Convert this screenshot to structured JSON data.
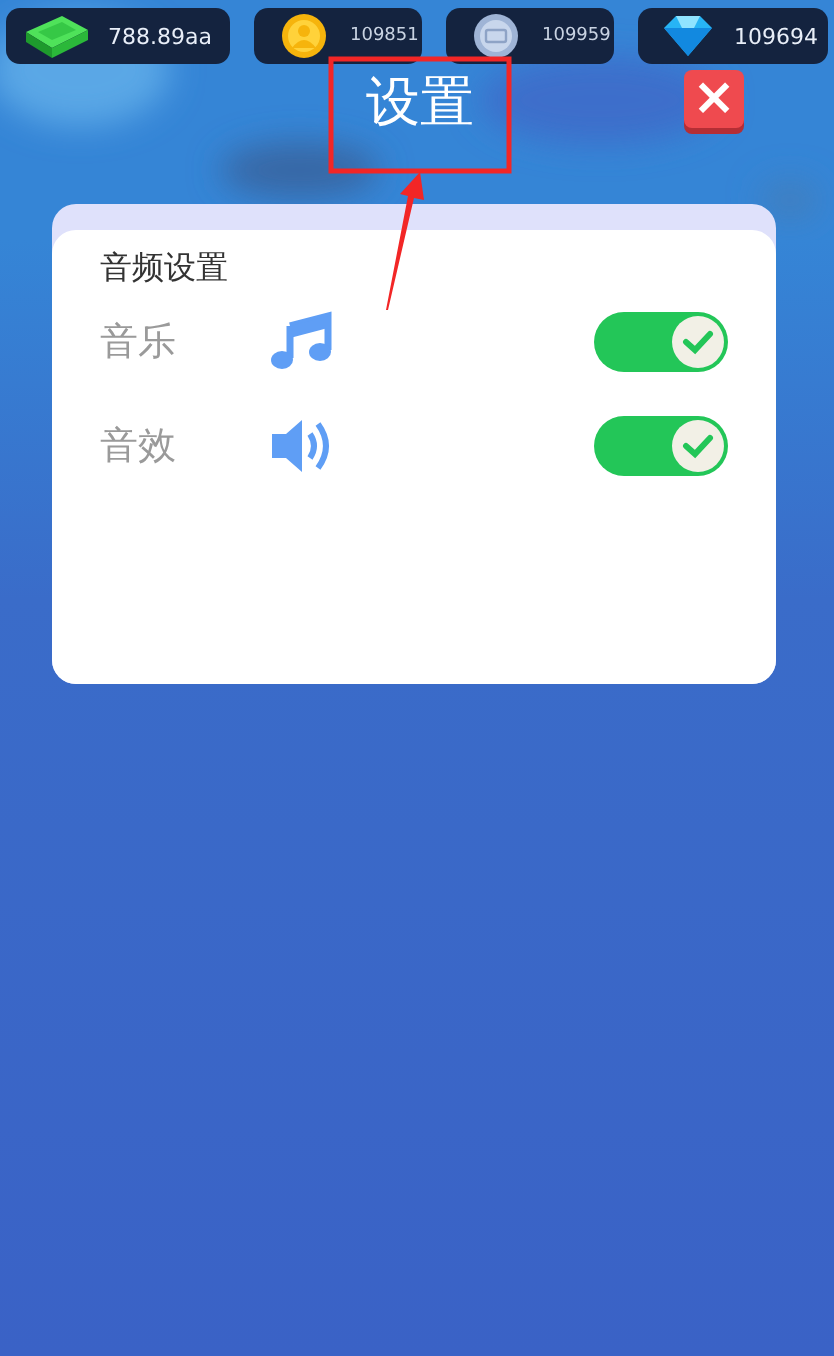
{
  "currencies": [
    {
      "kind": "cash",
      "amount": "788.89aa"
    },
    {
      "kind": "coin",
      "amount": "109851"
    },
    {
      "kind": "token",
      "amount": "109959"
    },
    {
      "kind": "gem",
      "amount": "109694"
    }
  ],
  "title": "设置",
  "close": {
    "label": "×"
  },
  "annotation": {
    "kind": "highlight-box-with-arrow"
  },
  "panel": {
    "section_title": "音频设置",
    "settings": [
      {
        "kind": "music",
        "label": "音乐",
        "on": true
      },
      {
        "kind": "sound",
        "label": "音效",
        "on": true
      }
    ]
  }
}
